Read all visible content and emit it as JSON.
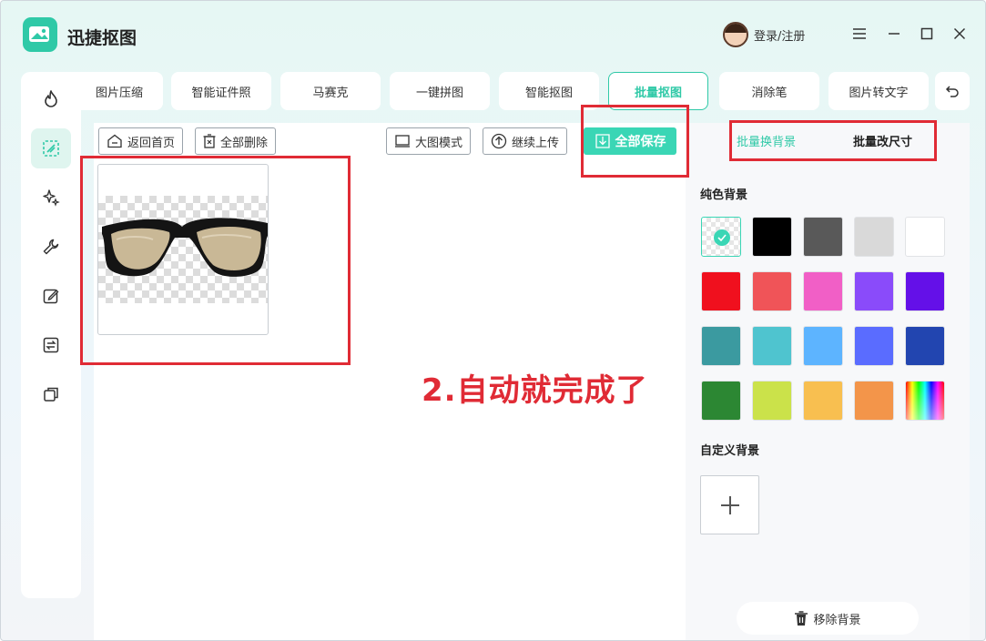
{
  "app": {
    "title": "迅捷抠图"
  },
  "header": {
    "login_label": "登录/注册"
  },
  "tabs": [
    {
      "label": "图片压缩",
      "active": false
    },
    {
      "label": "智能证件照",
      "active": false
    },
    {
      "label": "马赛克",
      "active": false
    },
    {
      "label": "一键拼图",
      "active": false
    },
    {
      "label": "智能抠图",
      "active": false
    },
    {
      "label": "批量抠图",
      "active": true
    },
    {
      "label": "消除笔",
      "active": false
    },
    {
      "label": "图片转文字",
      "active": false
    }
  ],
  "sidebar": {
    "icons": [
      "flame-icon",
      "batch-cutout-icon",
      "sparkle-icon",
      "wrench-icon",
      "edit-icon",
      "convert-icon",
      "copy-icon"
    ],
    "active_index": 1
  },
  "toolbar": {
    "home_label": "返回首页",
    "delete_all_label": "全部删除",
    "large_mode_label": "大图模式",
    "continue_upload_label": "继续上传",
    "save_all_label": "全部保存"
  },
  "right_panel": {
    "tab_bg_label": "批量换背景",
    "tab_size_label": "批量改尺寸",
    "solid_bg_heading": "纯色背景",
    "custom_bg_heading": "自定义背景",
    "remove_bg_label": "移除背景",
    "swatches": [
      [
        "transparent",
        "#000000",
        "#595959",
        "#d9d9d9",
        "#ffffff"
      ],
      [
        "#f0101e",
        "#f05458",
        "#f15fc6",
        "#8a4bfa",
        "#6410e8"
      ],
      [
        "#3b9aa0",
        "#4fc4cf",
        "#5db4ff",
        "#5a6cff",
        "#2245b0"
      ],
      [
        "#2c8733",
        "#cbe24a",
        "#f8bf50",
        "#f3954a",
        "rainbow"
      ]
    ],
    "selected_swatch": 0
  },
  "annotation": {
    "text": "2.自动就完成了",
    "color": "#e02b35"
  },
  "colors": {
    "accent": "#2fc9a7",
    "save_button": "#3ad6b5"
  }
}
